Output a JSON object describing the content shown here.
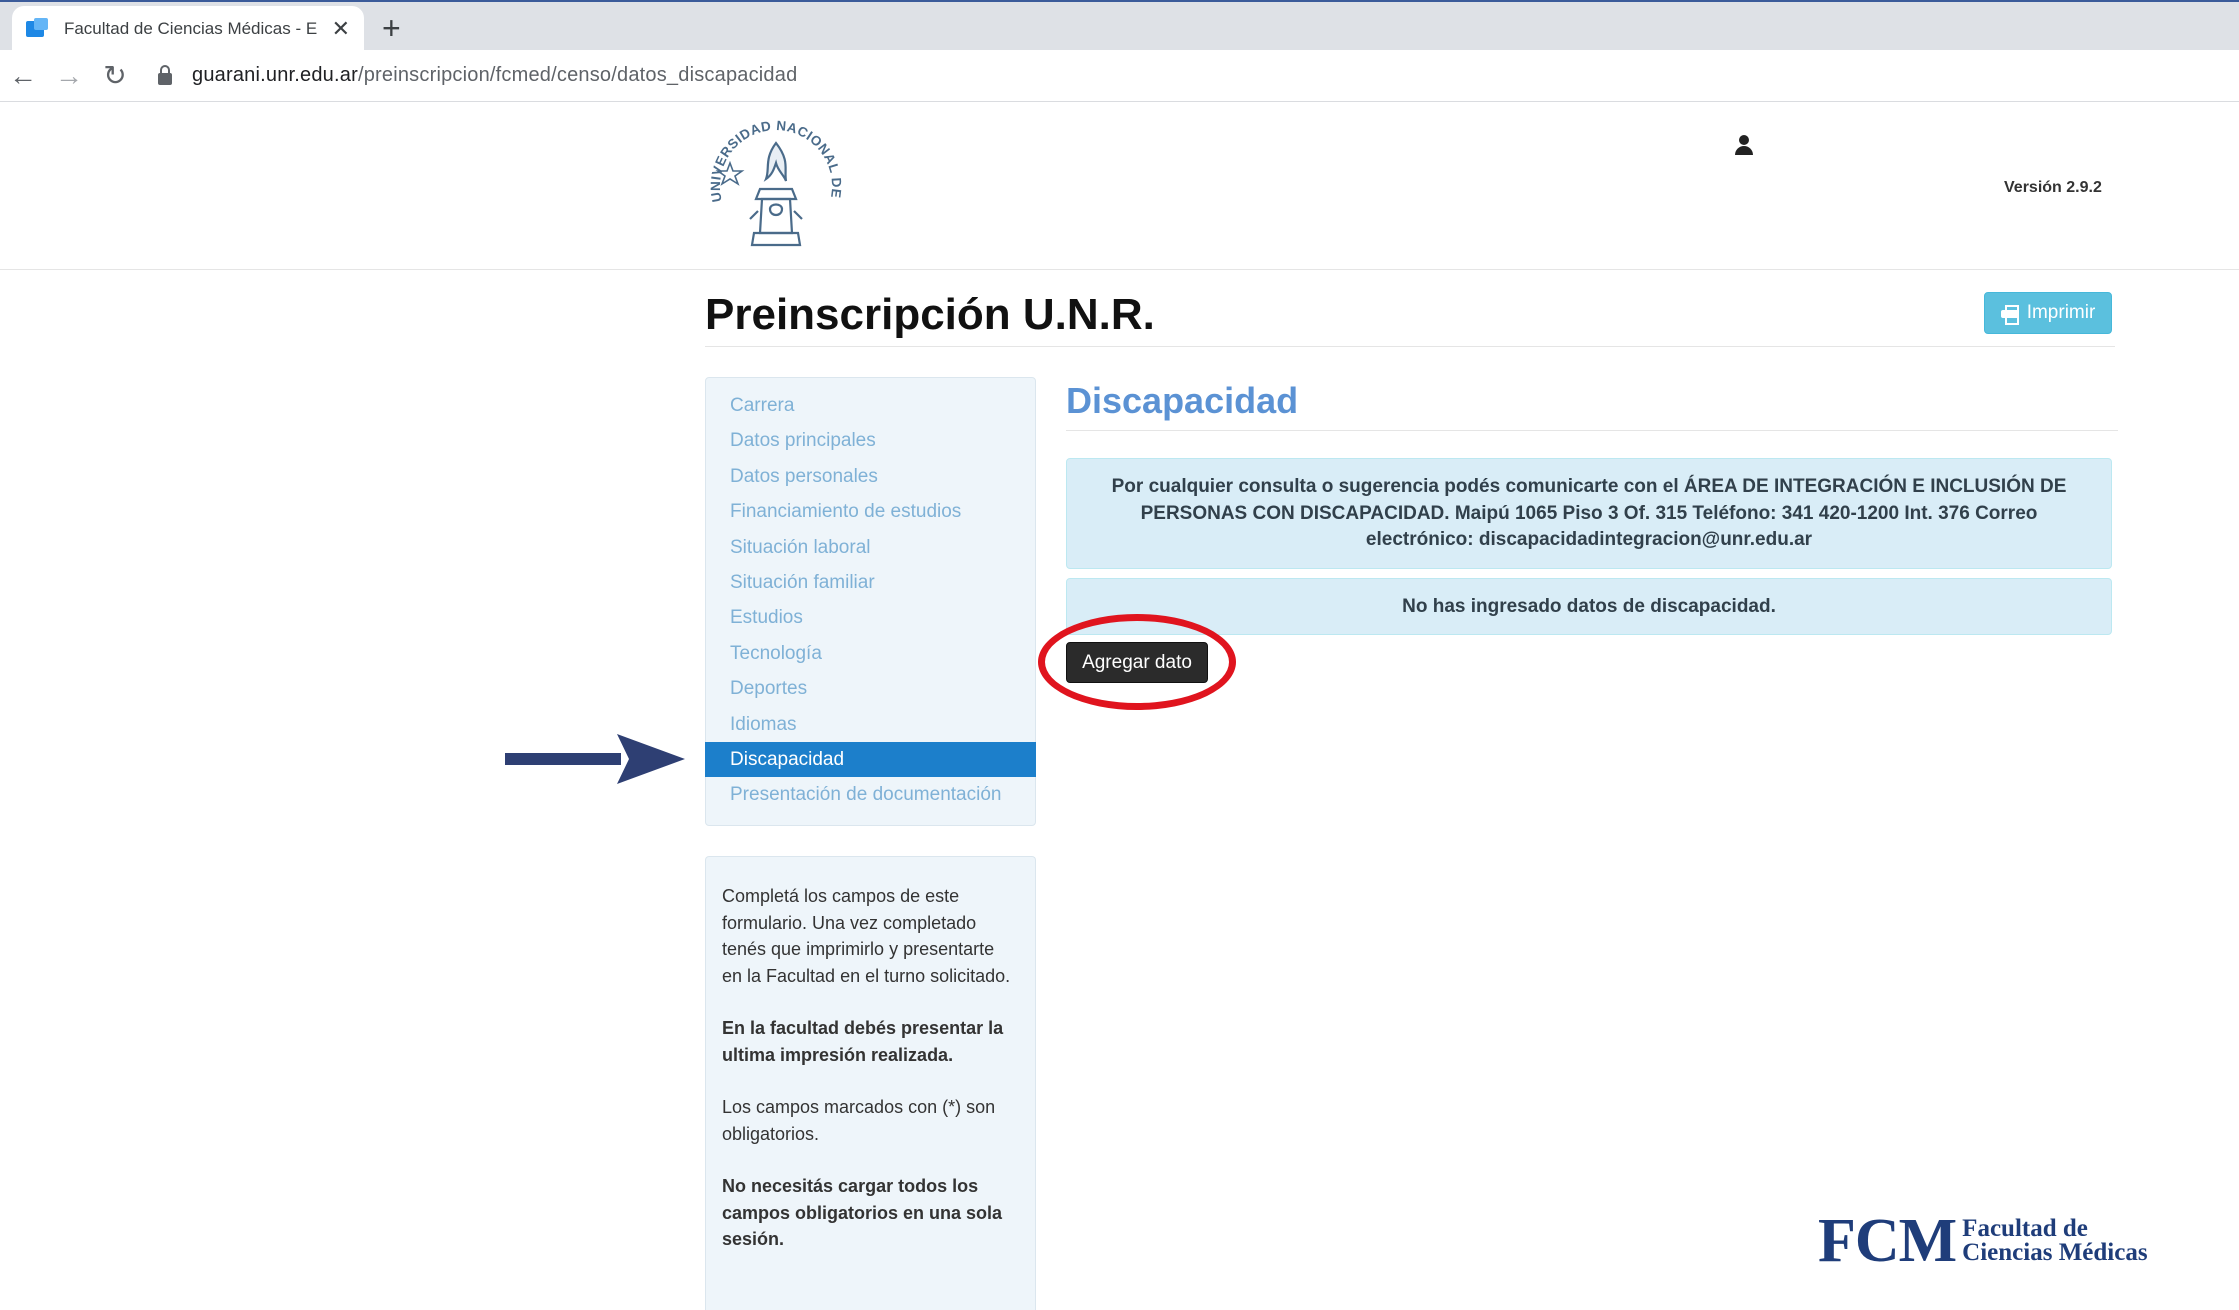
{
  "browser": {
    "tab_title": "Facultad de Ciencias Médicas - E",
    "tab_close": "✕",
    "new_tab": "+",
    "back": "←",
    "forward": "→",
    "reload": "↻",
    "url_host": "guarani.unr.edu.ar",
    "url_path": "/preinscripcion/fcmed/censo/datos_discapacidad"
  },
  "header": {
    "logo_text": "UNIVERSIDAD NACIONAL DE ROSARIO",
    "version": "Versión 2.9.2"
  },
  "page": {
    "title": "Preinscripción U.N.R.",
    "print_label": "Imprimir"
  },
  "sidebar": {
    "items": [
      {
        "label": "Carrera"
      },
      {
        "label": "Datos principales"
      },
      {
        "label": "Datos personales"
      },
      {
        "label": "Financiamiento de estudios"
      },
      {
        "label": "Situación laboral"
      },
      {
        "label": "Situación familiar"
      },
      {
        "label": "Estudios"
      },
      {
        "label": "Tecnología"
      },
      {
        "label": "Deportes"
      },
      {
        "label": "Idiomas"
      },
      {
        "label": "Discapacidad",
        "active": true
      },
      {
        "label": "Presentación de documentación"
      }
    ]
  },
  "info": {
    "p1": "Completá los campos de este formulario. Una vez completado tenés que imprimirlo y presentarte en la Facultad en el turno solicitado.",
    "p2": "En la facultad debés presentar la ultima impresión realizada.",
    "p3": "Los campos marcados con (*) son obligatorios.",
    "p4": "No necesitás cargar todos los campos obligatorios en una sola sesión."
  },
  "main": {
    "section_title": "Discapacidad",
    "contact_alert": "Por cualquier consulta o sugerencia podés comunicarte con el ÁREA DE INTEGRACIÓN E INCLUSIÓN DE PERSONAS CON DISCAPACIDAD. Maipú 1065 Piso 3 Of. 315 Teléfono: 341 420-1200 Int. 376 Correo electrónico: discapacidadintegracion@unr.edu.ar",
    "empty_alert": "No has ingresado datos de discapacidad.",
    "add_button": "Agregar dato"
  },
  "footer_logo": {
    "mark": "FCM",
    "line1": "Facultad de",
    "line2": "Ciencias Médicas"
  },
  "colors": {
    "accent": "#1c7fcb",
    "section_title": "#5b92d4",
    "alert_bg": "#d9edf7",
    "highlight": "#e0141e",
    "arrow": "#2e3f73"
  }
}
